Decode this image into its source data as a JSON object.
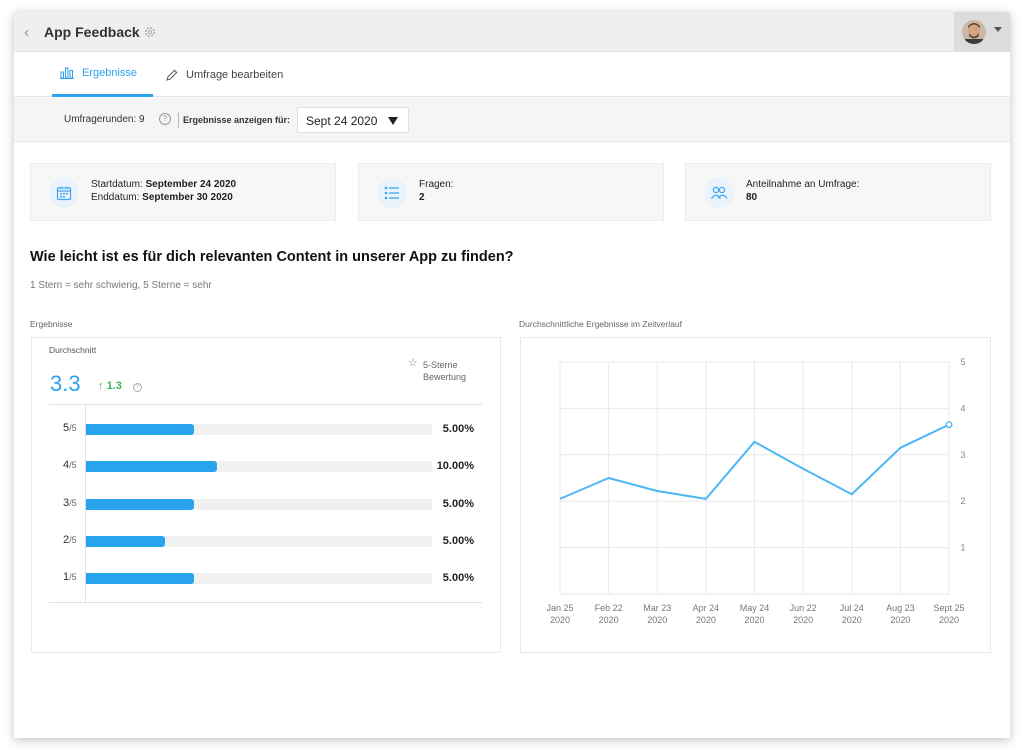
{
  "header": {
    "title": "App Feedback",
    "back_icon": "chevron-left-icon",
    "settings_icon": "gear-icon"
  },
  "tabs": [
    {
      "label": "Ergebnisse",
      "icon": "bar-chart-icon",
      "active": true
    },
    {
      "label": "Umfrage bearbeiten",
      "icon": "pencil-icon",
      "active": false
    }
  ],
  "filters": {
    "rounds_label": "Umfragerunden: 9",
    "show_for_label": "Ergebnisse anzeigen für:",
    "selected_date": "Sept 24 2020"
  },
  "stats": {
    "start_label": "Startdatum:",
    "start_value": "September 24 2020",
    "end_label": "Enddatum:",
    "end_value": "September 30 2020",
    "questions_label": "Fragen:",
    "questions_value": "2",
    "participation_label": "Anteilnahme an Umfrage:",
    "participation_value": "80"
  },
  "question": {
    "title": "Wie leicht ist es für dich relevanten Content in unserer App zu finden?",
    "scale_hint": "1 Stern = sehr schwierig, 5 Sterne = sehr"
  },
  "results": {
    "section_label": "Ergebnisse",
    "average_label": "Durchschnitt",
    "average_value": "3.3",
    "delta": "1.3",
    "rating_label_1": "5-Sterne",
    "rating_label_2": "Bewertung",
    "rows": [
      {
        "label": "5",
        "denom": "/5",
        "pct": "5.00%",
        "fraction": 0.312
      },
      {
        "label": "4",
        "denom": "/5",
        "pct": "10.00%",
        "fraction": 0.378
      },
      {
        "label": "3",
        "denom": "/5",
        "pct": "5.00%",
        "fraction": 0.312
      },
      {
        "label": "2",
        "denom": "/5",
        "pct": "5.00%",
        "fraction": 0.228
      },
      {
        "label": "1",
        "denom": "/5",
        "pct": "5.00%",
        "fraction": 0.312
      }
    ]
  },
  "chart_data": {
    "type": "line",
    "title": "Durchschnittliche Ergebnisse im Zeitverlauf",
    "x": [
      "Jan 25 2020",
      "Feb 22 2020",
      "Mar 23 2020",
      "Apr 24 2020",
      "May 24 2020",
      "Jun 22 2020",
      "Jul 24 2020",
      "Aug 23 2020",
      "Sept 25 2020"
    ],
    "x_tick_lines": [
      [
        "Jan 25",
        "2020"
      ],
      [
        "Feb 22",
        "2020"
      ],
      [
        "Mar 23",
        "2020"
      ],
      [
        "Apr 24",
        "2020"
      ],
      [
        "May 24",
        "2020"
      ],
      [
        "Jun 22",
        "2020"
      ],
      [
        "Jul 24",
        "2020"
      ],
      [
        "Aug 23",
        "2020"
      ],
      [
        "Sept 25",
        "2020"
      ]
    ],
    "series": [
      {
        "values": [
          2.05,
          2.5,
          2.22,
          2.05,
          3.28,
          2.7,
          2.15,
          3.15,
          3.65
        ]
      }
    ],
    "ylim": [
      0,
      5
    ],
    "yticks": [
      1,
      2,
      3,
      4,
      5
    ],
    "y_axis_side": "right",
    "grid": true,
    "color": "#4bb8f5"
  }
}
